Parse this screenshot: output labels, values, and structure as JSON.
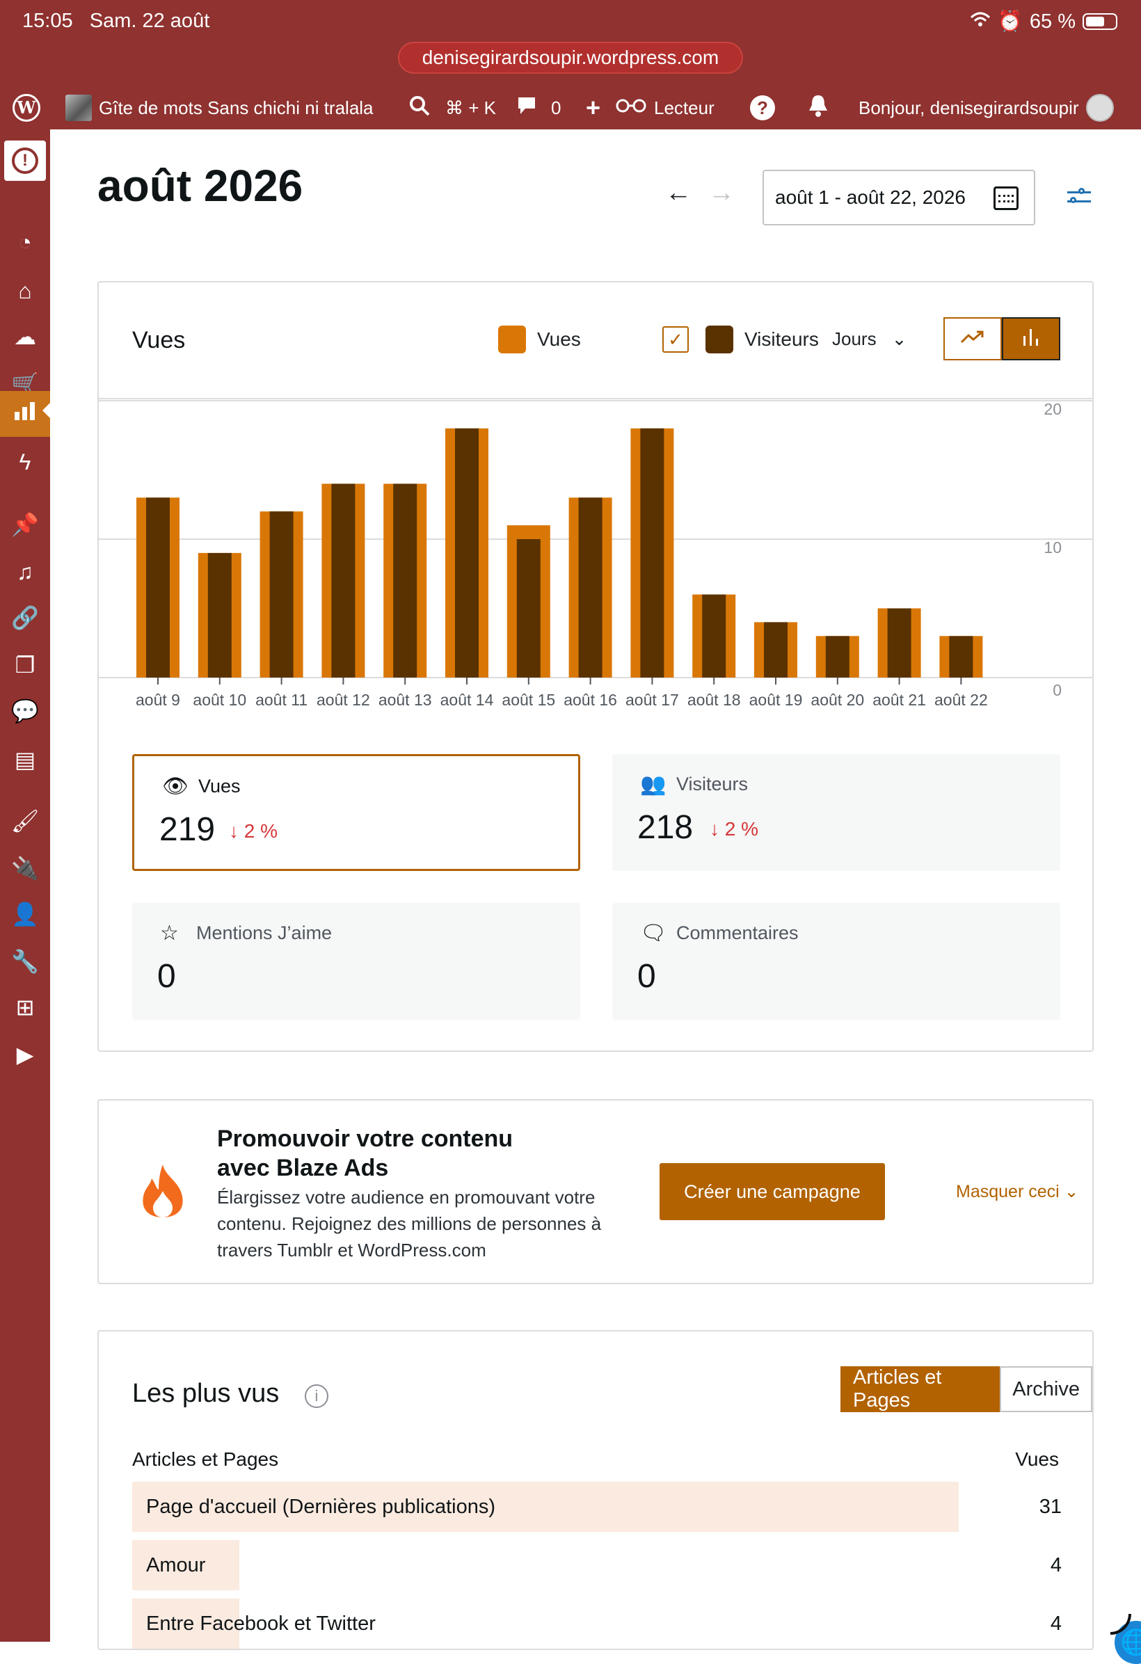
{
  "status": {
    "time": "15:05",
    "date": "Sam. 22 août",
    "battery": "65 %",
    "url": "denisegirardsoupir.wordpress.com"
  },
  "adminbar": {
    "site_name": "Gîte de mots Sans chichi ni tralala",
    "search_shortcut": "⌘ + K",
    "comments_count": "0",
    "reader_label": "Lecteur",
    "help": "?",
    "greeting": "Bonjour, denisegirardsoupir"
  },
  "header": {
    "title": "août 2026",
    "date_range": "août 1 - août 22, 2026"
  },
  "chart_card": {
    "title": "Vues",
    "legend_views": "Vues",
    "legend_visitors": "Visiteurs",
    "period": "Jours"
  },
  "colors": {
    "views": "#d97706",
    "visitors": "#5a3200",
    "accent": "#b26200",
    "sidebar": "#8f3230"
  },
  "chart_data": {
    "type": "bar",
    "categories": [
      "août 9",
      "août 10",
      "août 11",
      "août 12",
      "août 13",
      "août 14",
      "août 15",
      "août 16",
      "août 17",
      "août 18",
      "août 19",
      "août 20",
      "août 21",
      "août 22"
    ],
    "series": [
      {
        "name": "Vues",
        "values": [
          13,
          9,
          12,
          14,
          14,
          18,
          11,
          13,
          18,
          6,
          4,
          3,
          5,
          3
        ]
      },
      {
        "name": "Visiteurs",
        "values": [
          13,
          9,
          12,
          14,
          14,
          18,
          10,
          13,
          18,
          6,
          4,
          3,
          5,
          3
        ]
      }
    ],
    "yticks": [
      "0",
      "10",
      "20"
    ],
    "ylim": [
      0,
      20
    ],
    "grid": true
  },
  "stats": {
    "views": {
      "label": "Vues",
      "value": "219",
      "change": "↓ 2 %"
    },
    "visitors": {
      "label": "Visiteurs",
      "value": "218",
      "change": "↓ 2 %"
    },
    "likes": {
      "label": "Mentions J’aime",
      "value": "0"
    },
    "comments": {
      "label": "Commentaires",
      "value": "0"
    }
  },
  "blaze": {
    "title": "Promouvoir votre contenu avec Blaze Ads",
    "desc": "Élargissez votre audience en promouvant votre contenu. Rejoignez des millions de personnes à travers Tumblr et WordPress.com",
    "cta": "Créer une campagne",
    "hide": "Masquer ceci"
  },
  "top_posts": {
    "title": "Les plus vus",
    "tab_articles": "Articles et Pages",
    "tab_archive": "Archive",
    "col_title": "Articles et Pages",
    "col_views": "Vues",
    "rows": [
      {
        "title": "Page d'accueil (Dernières publications)",
        "views": "31",
        "fraction": 1.0
      },
      {
        "title": "Amour",
        "views": "4",
        "fraction": 0.13
      },
      {
        "title": "Entre Facebook et Twitter",
        "views": "4",
        "fraction": 0.13
      }
    ]
  }
}
